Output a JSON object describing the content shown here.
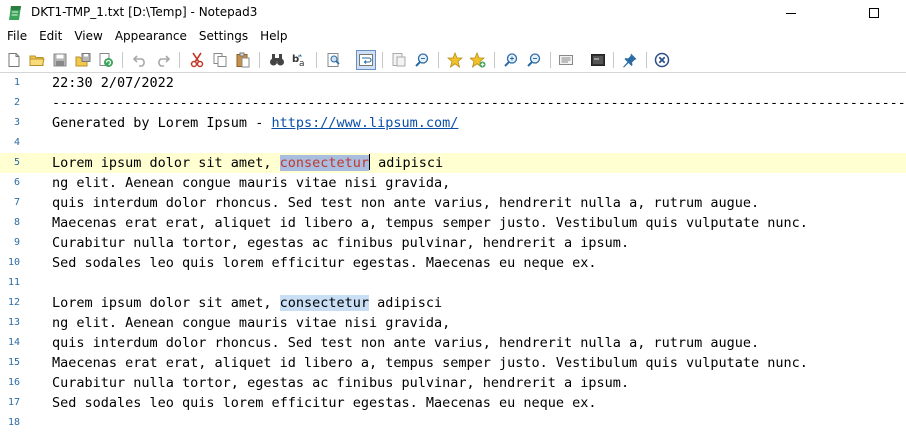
{
  "window": {
    "title": "DKT1-TMP_1.txt [D:\\Temp] - Notepad3"
  },
  "menu": [
    "File",
    "Edit",
    "View",
    "Appearance",
    "Settings",
    "Help"
  ],
  "toolbar_icons": [
    "new-file-icon",
    "open-folder-icon",
    "save-icon",
    "save-as-icon",
    "revert-icon",
    "undo-icon",
    "redo-icon",
    "cut-icon",
    "copy-icon",
    "paste-icon",
    "find-icon",
    "replace-icon",
    "find-in-files-icon",
    "word-wrap-icon",
    "line-numbers-icon",
    "zoom-text-icon",
    "favorite-icon",
    "add-favorite-icon",
    "zoom-in-icon",
    "zoom-out-icon",
    "scheme-icon",
    "customize-icon",
    "pin-icon",
    "exit-icon"
  ],
  "editor": {
    "current_line": 5,
    "lines": [
      {
        "n": "1",
        "text": "22:30 2/07/2022"
      },
      {
        "n": "2",
        "text": "---------------------------------------------------------------------------------------------------------------"
      },
      {
        "n": "3",
        "before": "Generated by Lorem Ipsum - ",
        "url": "https://www.lipsum.com/"
      },
      {
        "n": "4",
        "text": ""
      },
      {
        "n": "5",
        "before": "Lorem ipsum dolor sit amet, ",
        "highlight": "consectetur",
        "after": " adipisci"
      },
      {
        "n": "6",
        "text": "ng elit. Aenean congue mauris vitae nisi gravida,"
      },
      {
        "n": "7",
        "text": "quis interdum dolor rhoncus. Sed test non ante varius, hendrerit nulla a, rutrum augue."
      },
      {
        "n": "8",
        "text": "Maecenas erat erat, aliquet id libero a, tempus semper justo. Vestibulum quis vulputate nunc."
      },
      {
        "n": "9",
        "text": "Curabitur nulla tortor, egestas ac finibus pulvinar, hendrerit a ipsum."
      },
      {
        "n": "10",
        "text": "Sed sodales leo quis lorem efficitur egestas. Maecenas eu neque ex."
      },
      {
        "n": "11",
        "text": ""
      },
      {
        "n": "12",
        "before": "Lorem ipsum dolor sit amet, ",
        "highlight": "consectetur",
        "after": " adipisci"
      },
      {
        "n": "13",
        "text": "ng elit. Aenean congue mauris vitae nisi gravida,"
      },
      {
        "n": "14",
        "text": "quis interdum dolor rhoncus. Sed test non ante varius, hendrerit nulla a, rutrum augue."
      },
      {
        "n": "15",
        "text": "Maecenas erat erat, aliquet id libero a, tempus semper justo. Vestibulum quis vulputate nunc."
      },
      {
        "n": "16",
        "text": "Curabitur nulla tortor, egestas ac finibus pulvinar, hendrerit a ipsum."
      },
      {
        "n": "17",
        "text": "Sed sodales leo quis lorem efficitur egestas. Maecenas eu neque ex."
      },
      {
        "n": "18",
        "text": ""
      }
    ]
  },
  "colors": {
    "current_line": "#ffffd2",
    "selection": "#a8bde0",
    "selection_text": "#c0392b",
    "match_mark": "#c9dff5",
    "line_numbers": "#2b6ca3",
    "url": "#0b4fa8"
  }
}
